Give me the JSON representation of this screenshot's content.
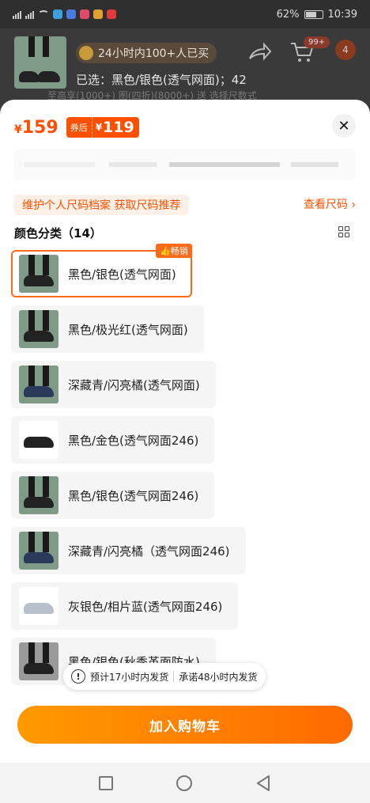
{
  "status": {
    "network": "4G",
    "battery": "62%",
    "time": "10:39"
  },
  "header": {
    "banner": "24小时内100+人已买",
    "cart_count": "99+",
    "badge_count": "4",
    "selected": "已选：黑色/银色(透气网面)；42",
    "hidden_text": "至高享(1000+)    图(四折)(8000+)    送 选择尺数式"
  },
  "price": {
    "currency": "¥",
    "original": "159",
    "coupon_label": "券后",
    "coupon_price": "119"
  },
  "size_tip": "维护个人尺码档案 获取尺码推荐",
  "size_link": "查看尺码 ›",
  "color_section": {
    "title": "颜色分类（14）"
  },
  "options": [
    {
      "label": "黑色/银色(透气网面)",
      "selected": true,
      "badge": "畅销",
      "thumb": "photo-legs-black"
    },
    {
      "label": "黑色/极光红(透气网面)",
      "selected": false,
      "thumb": "photo-legs-black"
    },
    {
      "label": "深藏青/闪亮橘(透气网面)",
      "selected": false,
      "thumb": "photo-legs-navy"
    },
    {
      "label": "黑色/金色(透气网面246)",
      "selected": false,
      "thumb": "white-shoe-black"
    },
    {
      "label": "黑色/银色(透气网面246)",
      "selected": false,
      "thumb": "photo-legs-black"
    },
    {
      "label": "深藏青/闪亮橘（透气网面246)",
      "selected": false,
      "thumb": "photo-legs-navy"
    },
    {
      "label": "灰银色/相片蓝(透气网面246)",
      "selected": false,
      "thumb": "white-shoe-grey"
    },
    {
      "label": "黑色/银色(秋季革面防水)",
      "selected": false,
      "thumb": "photo-legs-black"
    }
  ],
  "shipping": {
    "estimate": "预计17小时内发货",
    "promise": "承诺48小时内发货"
  },
  "add_cart_label": "加入购物车",
  "colors": {
    "accent": "#ff5000",
    "button_start": "#ff9a00",
    "button_end": "#ff6a00"
  }
}
